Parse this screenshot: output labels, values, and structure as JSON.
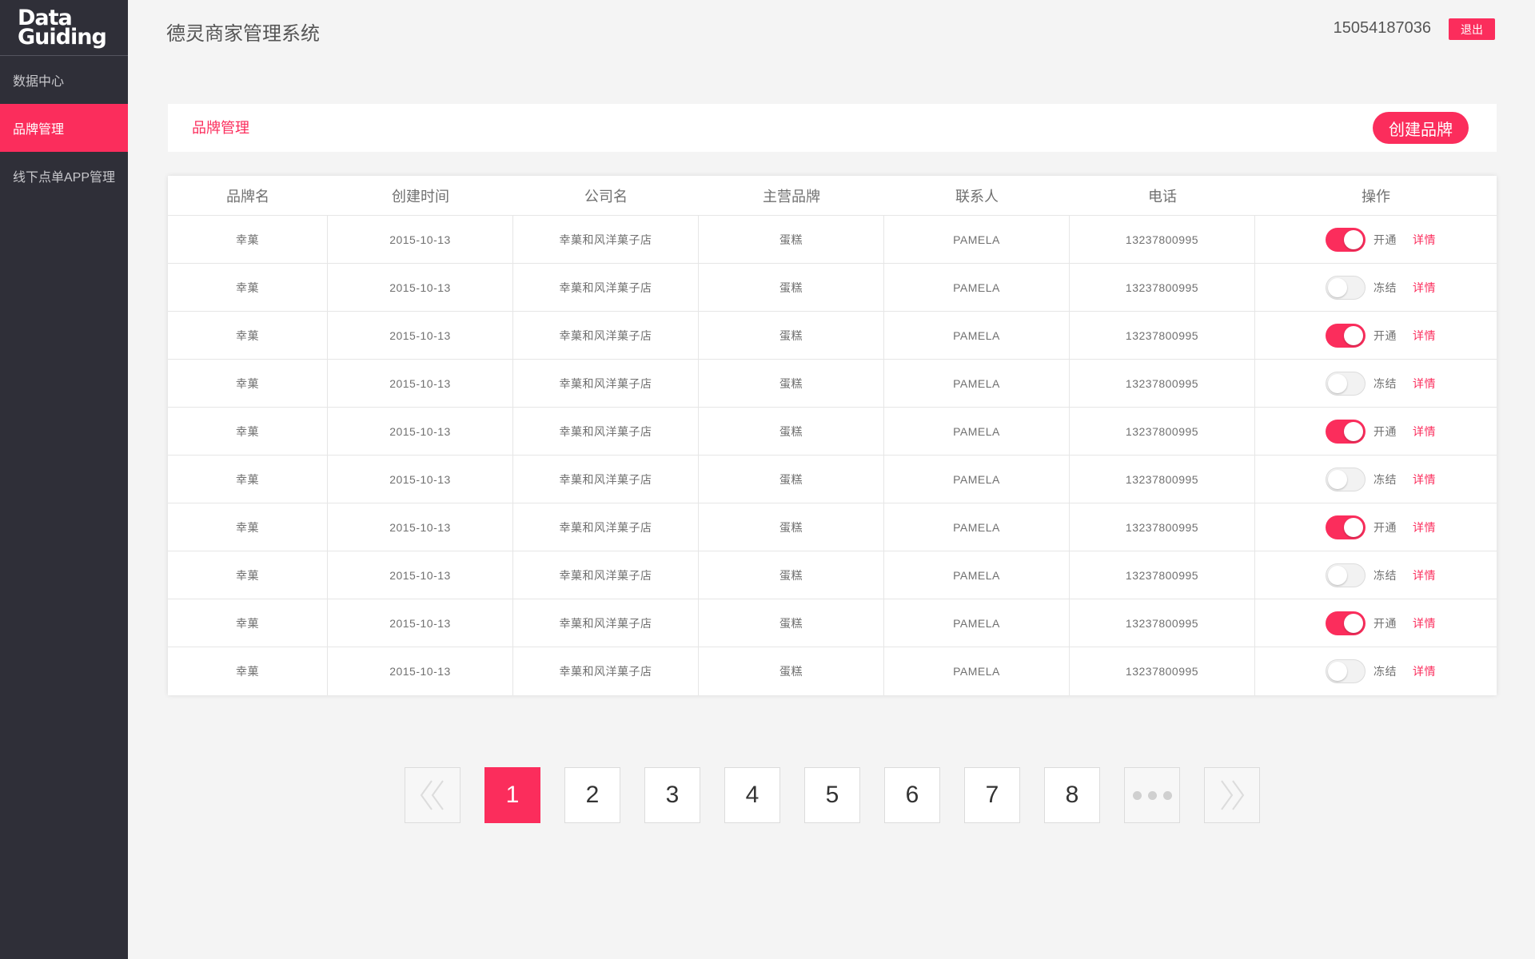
{
  "sidebar": {
    "logo_line1": "Data",
    "logo_line2": "Guiding",
    "items": [
      {
        "label": "数据中心"
      },
      {
        "label": "品牌管理"
      },
      {
        "label": "线下点单APP管理"
      }
    ]
  },
  "header": {
    "title": "德灵商家管理系统",
    "phone": "15054187036",
    "logout_label": "退出"
  },
  "page": {
    "title": "品牌管理",
    "create_label": "创建品牌"
  },
  "table": {
    "columns": [
      "品牌名",
      "创建时间",
      "公司名",
      "主营品牌",
      "联系人",
      "电话",
      "操作"
    ],
    "detail_label": "详情",
    "rows": [
      {
        "brand": "幸菓",
        "created": "2015-10-13",
        "company": "幸菓和风洋菓子店",
        "main_brand": "蛋糕",
        "contact": "PAMELA",
        "phone": "13237800995",
        "status": "开通",
        "on": true
      },
      {
        "brand": "幸菓",
        "created": "2015-10-13",
        "company": "幸菓和风洋菓子店",
        "main_brand": "蛋糕",
        "contact": "PAMELA",
        "phone": "13237800995",
        "status": "冻结",
        "on": false
      },
      {
        "brand": "幸菓",
        "created": "2015-10-13",
        "company": "幸菓和风洋菓子店",
        "main_brand": "蛋糕",
        "contact": "PAMELA",
        "phone": "13237800995",
        "status": "开通",
        "on": true
      },
      {
        "brand": "幸菓",
        "created": "2015-10-13",
        "company": "幸菓和风洋菓子店",
        "main_brand": "蛋糕",
        "contact": "PAMELA",
        "phone": "13237800995",
        "status": "冻结",
        "on": false
      },
      {
        "brand": "幸菓",
        "created": "2015-10-13",
        "company": "幸菓和风洋菓子店",
        "main_brand": "蛋糕",
        "contact": "PAMELA",
        "phone": "13237800995",
        "status": "开通",
        "on": true
      },
      {
        "brand": "幸菓",
        "created": "2015-10-13",
        "company": "幸菓和风洋菓子店",
        "main_brand": "蛋糕",
        "contact": "PAMELA",
        "phone": "13237800995",
        "status": "冻结",
        "on": false
      },
      {
        "brand": "幸菓",
        "created": "2015-10-13",
        "company": "幸菓和风洋菓子店",
        "main_brand": "蛋糕",
        "contact": "PAMELA",
        "phone": "13237800995",
        "status": "开通",
        "on": true
      },
      {
        "brand": "幸菓",
        "created": "2015-10-13",
        "company": "幸菓和风洋菓子店",
        "main_brand": "蛋糕",
        "contact": "PAMELA",
        "phone": "13237800995",
        "status": "冻结",
        "on": false
      },
      {
        "brand": "幸菓",
        "created": "2015-10-13",
        "company": "幸菓和风洋菓子店",
        "main_brand": "蛋糕",
        "contact": "PAMELA",
        "phone": "13237800995",
        "status": "开通",
        "on": true
      },
      {
        "brand": "幸菓",
        "created": "2015-10-13",
        "company": "幸菓和风洋菓子店",
        "main_brand": "蛋糕",
        "contact": "PAMELA",
        "phone": "13237800995",
        "status": "冻结",
        "on": false
      }
    ]
  },
  "pagination": {
    "prev_icon": "double-chevron-left-icon",
    "next_icon": "double-chevron-right-icon",
    "pages": [
      "1",
      "2",
      "3",
      "4",
      "5",
      "6",
      "7",
      "8"
    ],
    "current": "1"
  },
  "colors": {
    "accent": "#fb2d5c",
    "sidebar_bg": "#2f2f38",
    "page_bg": "#f4f4f4",
    "text": "#707070",
    "pager_border": "#dcdcdc",
    "pager_arrow_bg": "#f7f7f7"
  }
}
